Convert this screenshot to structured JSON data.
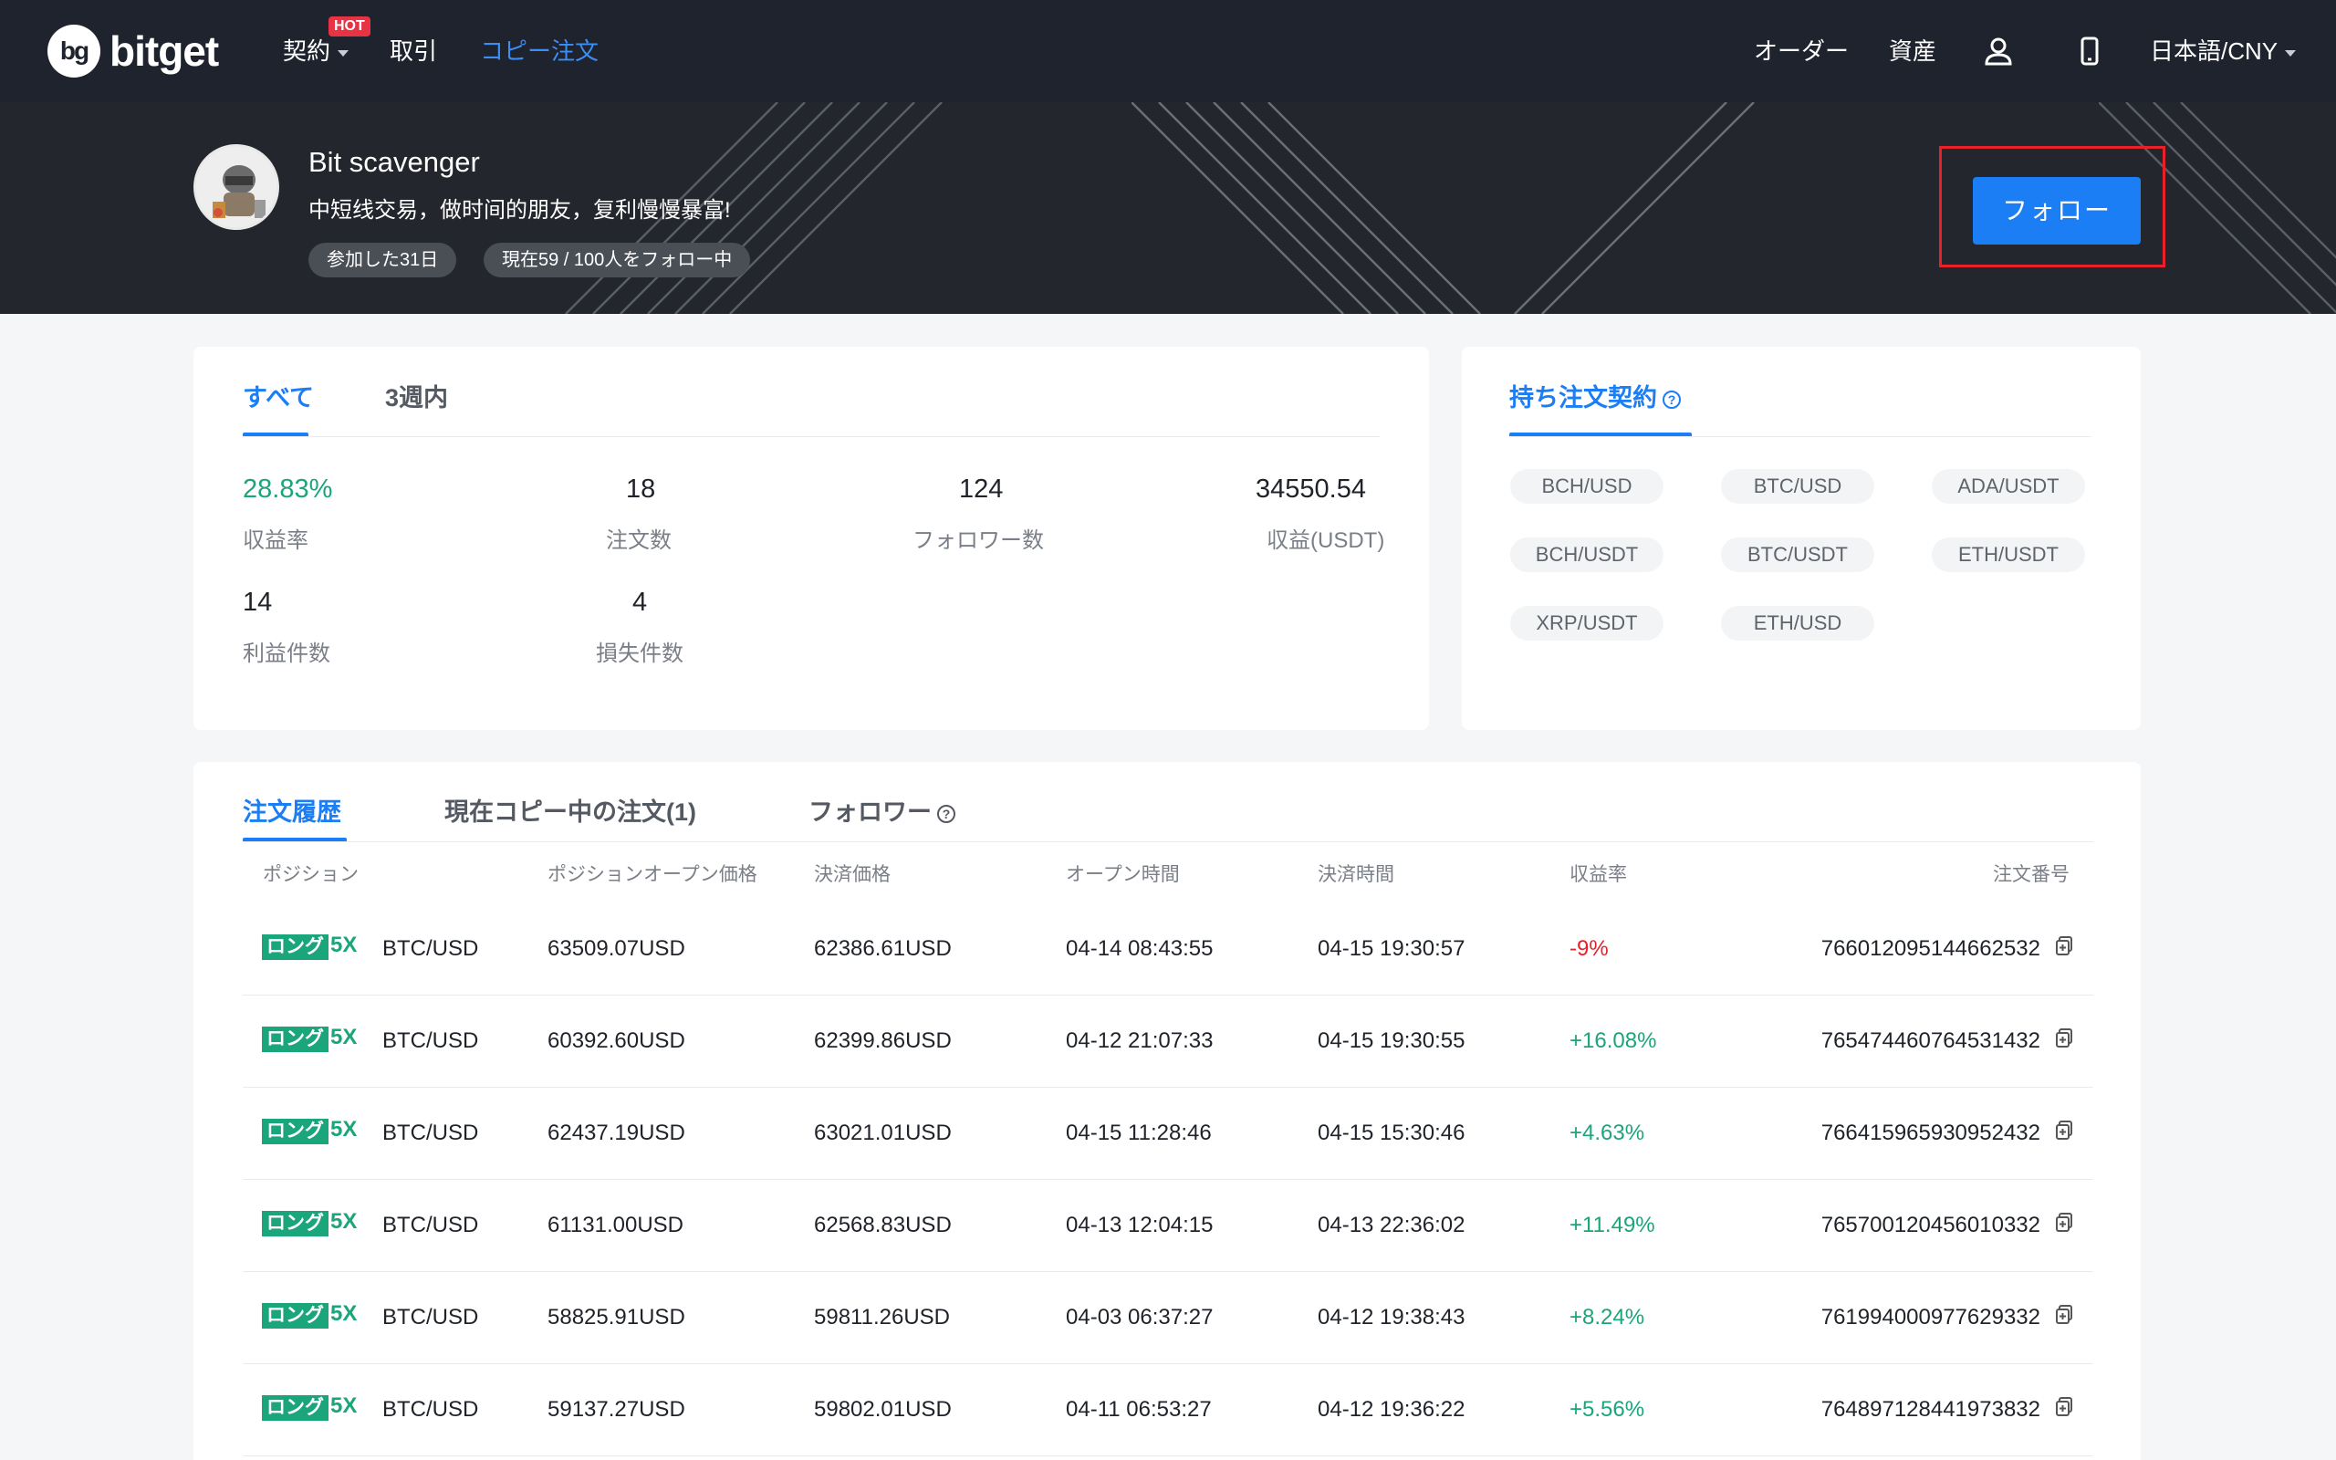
{
  "nav": {
    "logo_text": "bitget",
    "items": [
      {
        "label": "契約",
        "hot": "HOT"
      },
      {
        "label": "取引"
      },
      {
        "label": "コピー注文"
      }
    ],
    "right": {
      "orders": "オーダー",
      "assets": "資産",
      "language": "日本語/CNY"
    }
  },
  "trader": {
    "name": "Bit scavenger",
    "bio": "中短线交易，做时间的朋友，复利慢慢暴富!",
    "joined": "参加した31日",
    "following": "現在59 / 100人をフォロー中",
    "follow_button": "フォロー"
  },
  "stats": {
    "tabs": [
      "すべて",
      "3週内"
    ],
    "items": [
      {
        "value": "28.83%",
        "label": "収益率"
      },
      {
        "value": "18",
        "label": "注文数"
      },
      {
        "value": "124",
        "label": "フォロワー数"
      },
      {
        "value": "34550.54",
        "label": "収益(USDT)"
      },
      {
        "value": "14",
        "label": "利益件数"
      },
      {
        "value": "4",
        "label": "損失件数"
      }
    ]
  },
  "contracts": {
    "title": "持ち注文契約",
    "pairs": [
      "BCH/USD",
      "BTC/USD",
      "ADA/USDT",
      "BCH/USDT",
      "BTC/USDT",
      "ETH/USDT",
      "XRP/USDT",
      "ETH/USD"
    ]
  },
  "orders": {
    "tabs": [
      "注文履歴",
      "現在コピー中の注文(1)",
      "フォロワー"
    ],
    "columns": [
      "ポジション",
      "ポジションオープン価格",
      "決済価格",
      "オープン時間",
      "決済時間",
      "収益率",
      "注文番号"
    ],
    "long_label": "ロング",
    "rows": [
      {
        "lev": "5X",
        "pair": "BTC/USD",
        "open": "63509.07USD",
        "close": "62386.61USD",
        "open_time": "04-14 08:43:55",
        "close_time": "04-15 19:30:57",
        "rate": "-9%",
        "order_no": "766012095144662532"
      },
      {
        "lev": "5X",
        "pair": "BTC/USD",
        "open": "60392.60USD",
        "close": "62399.86USD",
        "open_time": "04-12 21:07:33",
        "close_time": "04-15 19:30:55",
        "rate": "+16.08%",
        "order_no": "765474460764531432"
      },
      {
        "lev": "5X",
        "pair": "BTC/USD",
        "open": "62437.19USD",
        "close": "63021.01USD",
        "open_time": "04-15 11:28:46",
        "close_time": "04-15 15:30:46",
        "rate": "+4.63%",
        "order_no": "766415965930952432"
      },
      {
        "lev": "5X",
        "pair": "BTC/USD",
        "open": "61131.00USD",
        "close": "62568.83USD",
        "open_time": "04-13 12:04:15",
        "close_time": "04-13 22:36:02",
        "rate": "+11.49%",
        "order_no": "765700120456010332"
      },
      {
        "lev": "5X",
        "pair": "BTC/USD",
        "open": "58825.91USD",
        "close": "59811.26USD",
        "open_time": "04-03 06:37:27",
        "close_time": "04-12 19:38:43",
        "rate": "+8.24%",
        "order_no": "761994000977629332"
      },
      {
        "lev": "5X",
        "pair": "BTC/USD",
        "open": "59137.27USD",
        "close": "59802.01USD",
        "open_time": "04-11 06:53:27",
        "close_time": "04-12 19:36:22",
        "rate": "+5.56%",
        "order_no": "764897128441973832"
      }
    ]
  }
}
